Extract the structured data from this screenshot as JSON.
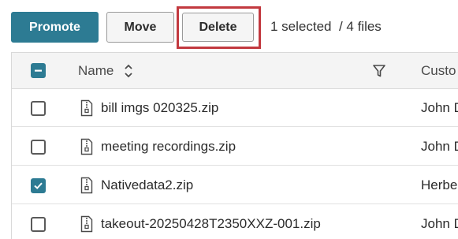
{
  "toolbar": {
    "promote_label": "Promote",
    "move_label": "Move",
    "delete_label": "Delete",
    "selection_text": "1 selected  / 4 files"
  },
  "table": {
    "columns": {
      "name": "Name",
      "customer": "Custo"
    },
    "rows": [
      {
        "filename": "bill imgs 020325.zip",
        "customer": "John D",
        "checked": false
      },
      {
        "filename": "meeting recordings.zip",
        "customer": "John D",
        "checked": false
      },
      {
        "filename": "Nativedata2.zip",
        "customer": "Herbe",
        "checked": true
      },
      {
        "filename": "takeout-20250428T2350XXZ-001.zip",
        "customer": "John D",
        "checked": false
      }
    ]
  },
  "colors": {
    "accent": "#2d7b93",
    "highlight": "#c2393f"
  }
}
